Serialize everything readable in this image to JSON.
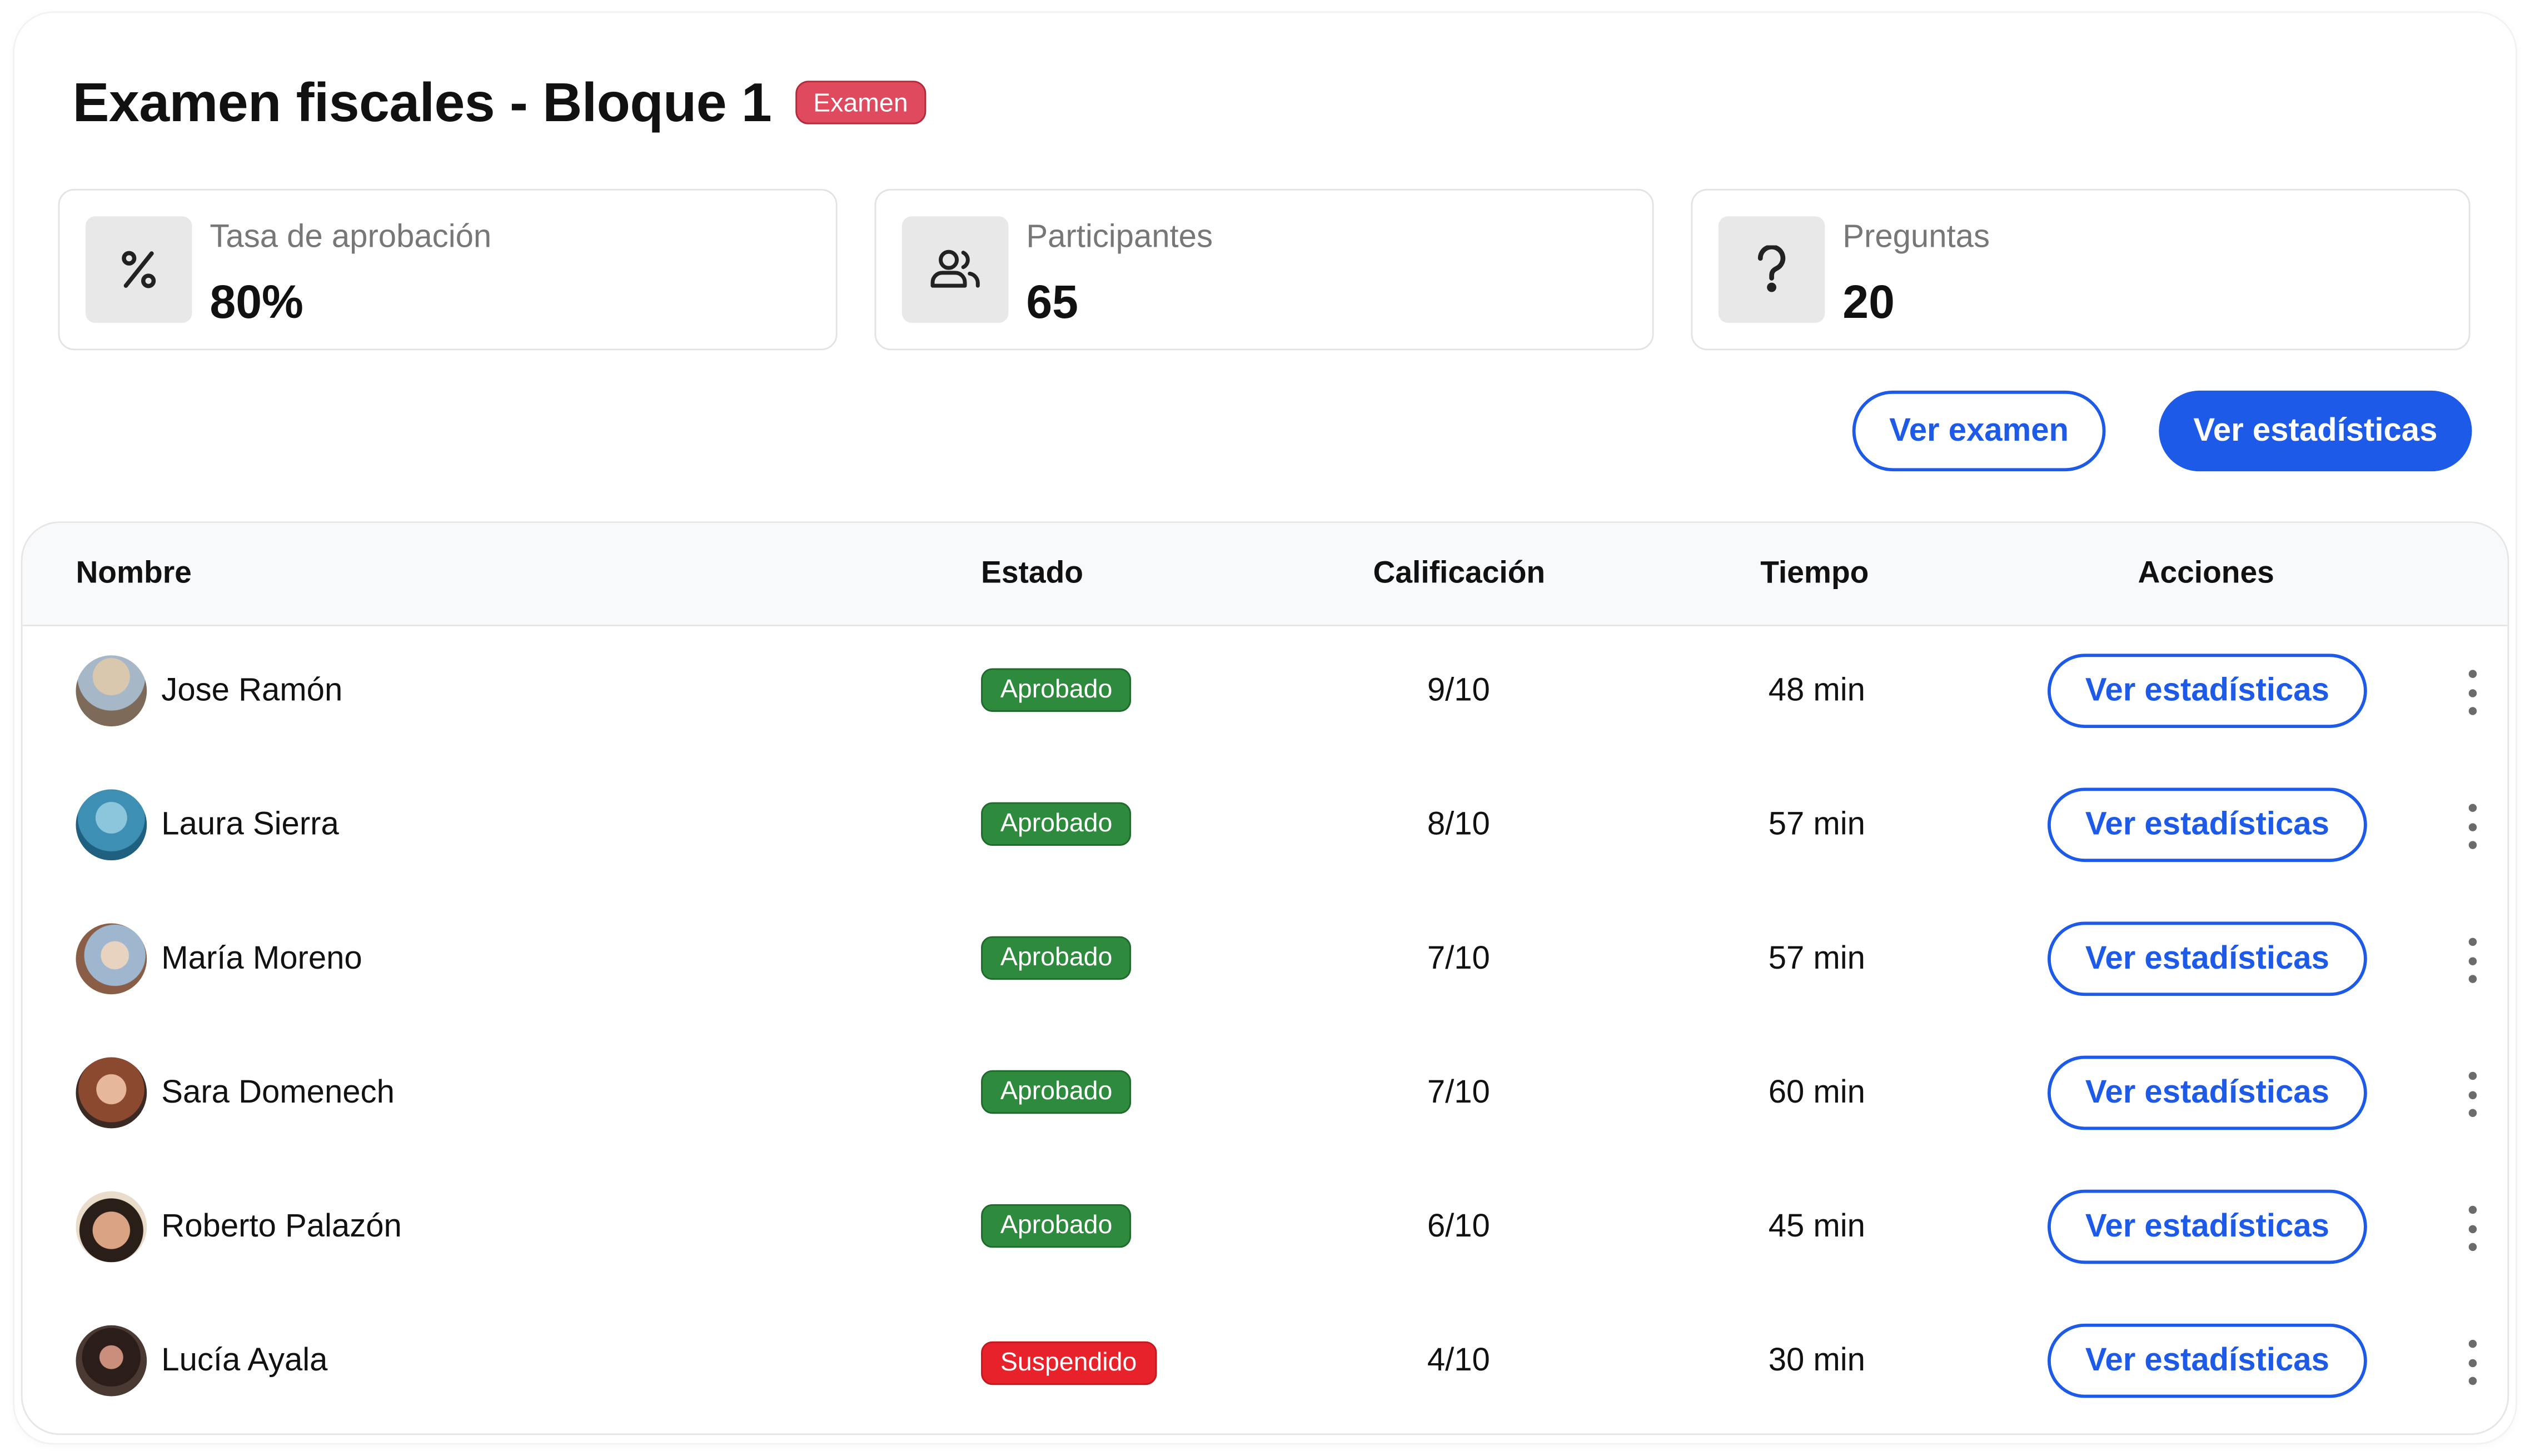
{
  "header": {
    "title": "Examen fiscales - Bloque 1",
    "badge": "Examen",
    "badge_color": "#e04a5f"
  },
  "stats": [
    {
      "icon": "percent-icon",
      "label": "Tasa de aprobación",
      "value": "80%"
    },
    {
      "icon": "users-icon",
      "label": "Participantes",
      "value": "65"
    },
    {
      "icon": "question-icon",
      "label": "Preguntas",
      "value": "20"
    }
  ],
  "actions": {
    "view_exam": "Ver examen",
    "view_stats": "Ver estadísticas",
    "accent_color": "#1d5ae8"
  },
  "table": {
    "columns": [
      "Nombre",
      "Estado",
      "Calificación",
      "Tiempo",
      "Acciones"
    ],
    "rows": [
      {
        "name": "Jose Ramón",
        "status": "Aprobado",
        "grade": "9/10",
        "time": "48 min",
        "action": "Ver estadísticas"
      },
      {
        "name": "Laura Sierra",
        "status": "Aprobado",
        "grade": "8/10",
        "time": "57 min",
        "action": "Ver estadísticas"
      },
      {
        "name": "María Moreno",
        "status": "Aprobado",
        "grade": "7/10",
        "time": "57 min",
        "action": "Ver estadísticas"
      },
      {
        "name": "Sara Domenech",
        "status": "Aprobado",
        "grade": "7/10",
        "time": "60 min",
        "action": "Ver estadísticas"
      },
      {
        "name": "Roberto Palazón",
        "status": "Aprobado",
        "grade": "6/10",
        "time": "45 min",
        "action": "Ver estadísticas"
      },
      {
        "name": "Lucía Ayala",
        "status": "Suspendido",
        "grade": "4/10",
        "time": "30 min",
        "action": "Ver estadísticas"
      }
    ],
    "status_colors": {
      "Aprobado": "#2e8b3e",
      "Suspendido": "#e8222a"
    }
  }
}
